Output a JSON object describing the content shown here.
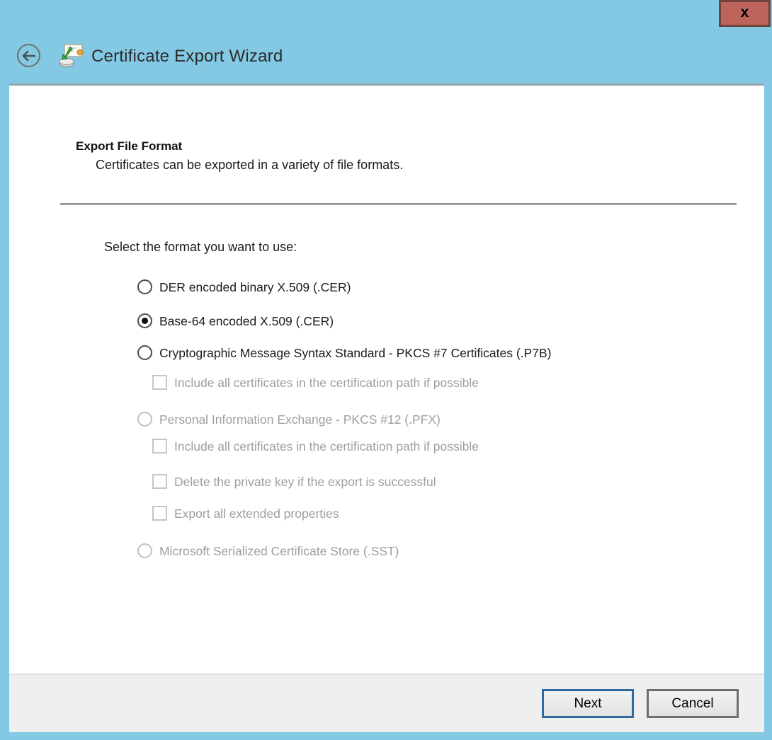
{
  "window": {
    "title": "Certificate Export Wizard",
    "close_glyph": "x"
  },
  "step": {
    "heading": "Export File Format",
    "subheading": "Certificates can be exported in a variety of file formats."
  },
  "format": {
    "prompt": "Select the format you want to use:",
    "options": [
      {
        "label": "DER encoded binary X.509 (.CER)",
        "selected": false,
        "enabled": true
      },
      {
        "label": "Base-64 encoded X.509 (.CER)",
        "selected": true,
        "enabled": true
      },
      {
        "label": "Cryptographic Message Syntax Standard - PKCS #7 Certificates (.P7B)",
        "selected": false,
        "enabled": true,
        "children": [
          {
            "label": "Include all certificates in the certification path if possible",
            "checked": false,
            "enabled": false
          }
        ]
      },
      {
        "label": "Personal Information Exchange - PKCS #12 (.PFX)",
        "selected": false,
        "enabled": false,
        "children": [
          {
            "label": "Include all certificates in the certification path if possible",
            "checked": false,
            "enabled": false
          },
          {
            "label": "Delete the private key if the export is successful",
            "checked": false,
            "enabled": false
          },
          {
            "label": "Export all extended properties",
            "checked": false,
            "enabled": false
          }
        ]
      },
      {
        "label": "Microsoft Serialized Certificate Store (.SST)",
        "selected": false,
        "enabled": false
      }
    ]
  },
  "footer": {
    "next_label": "Next",
    "cancel_label": "Cancel"
  },
  "colors": {
    "window_chrome": "#84C9E4",
    "close_button": "#BD655D",
    "close_button_border": "#6F423C",
    "focus_border": "#2D6B9F",
    "disabled_text": "#9E9E9E",
    "panel_background": "#FFFFFF",
    "footer_background": "#EFEFEF"
  }
}
